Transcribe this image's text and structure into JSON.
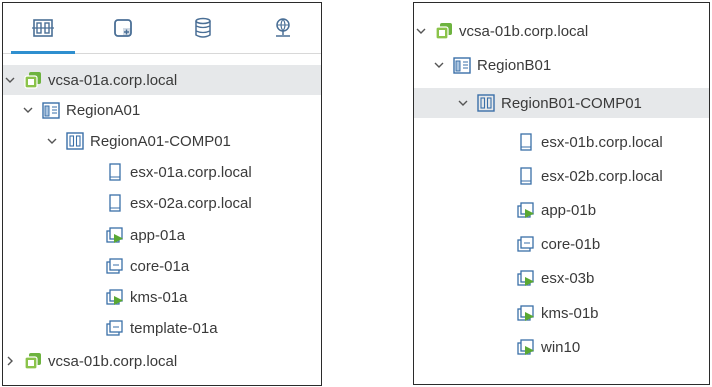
{
  "left_panel": {
    "tabs": [
      {
        "icon": "hosts-clusters-icon",
        "active": true
      },
      {
        "icon": "vms-templates-icon",
        "active": false
      },
      {
        "icon": "storage-icon",
        "active": false
      },
      {
        "icon": "networking-icon",
        "active": false
      }
    ],
    "tree": [
      {
        "label": "vcsa-01a.corp.local",
        "icon": "vcenter-icon",
        "expanded": true,
        "selected": true
      },
      {
        "label": "RegionA01",
        "icon": "datacenter-icon",
        "expanded": true
      },
      {
        "label": "RegionA01-COMP01",
        "icon": "cluster-icon",
        "expanded": true
      },
      {
        "label": "esx-01a.corp.local",
        "icon": "host-icon"
      },
      {
        "label": "esx-02a.corp.local",
        "icon": "host-icon"
      },
      {
        "label": "app-01a",
        "icon": "vm-powered-on-icon"
      },
      {
        "label": "core-01a",
        "icon": "vm-icon"
      },
      {
        "label": "kms-01a",
        "icon": "vm-powered-on-icon"
      },
      {
        "label": "template-01a",
        "icon": "vm-icon"
      },
      {
        "label": "vcsa-01b.corp.local",
        "icon": "vcenter-icon",
        "expanded": false
      }
    ]
  },
  "right_panel": {
    "tree": [
      {
        "label": "vcsa-01b.corp.local",
        "icon": "vcenter-icon",
        "expanded": true
      },
      {
        "label": "RegionB01",
        "icon": "datacenter-icon",
        "expanded": true
      },
      {
        "label": "RegionB01-COMP01",
        "icon": "cluster-icon",
        "expanded": true,
        "selected": true
      },
      {
        "label": "esx-01b.corp.local",
        "icon": "host-icon"
      },
      {
        "label": "esx-02b.corp.local",
        "icon": "host-icon"
      },
      {
        "label": "app-01b",
        "icon": "vm-powered-on-icon"
      },
      {
        "label": "core-01b",
        "icon": "vm-icon"
      },
      {
        "label": "esx-03b",
        "icon": "vm-powered-on-icon"
      },
      {
        "label": "kms-01b",
        "icon": "vm-powered-on-icon"
      },
      {
        "label": "win10",
        "icon": "vm-powered-on-icon"
      }
    ]
  },
  "colors": {
    "accent": "#2f8fcf",
    "vcenter_green": "#6db33f",
    "vm_green": "#5aa832",
    "icon_blue": "#3a6fa8",
    "selected_bg": "#e6e8ea"
  }
}
